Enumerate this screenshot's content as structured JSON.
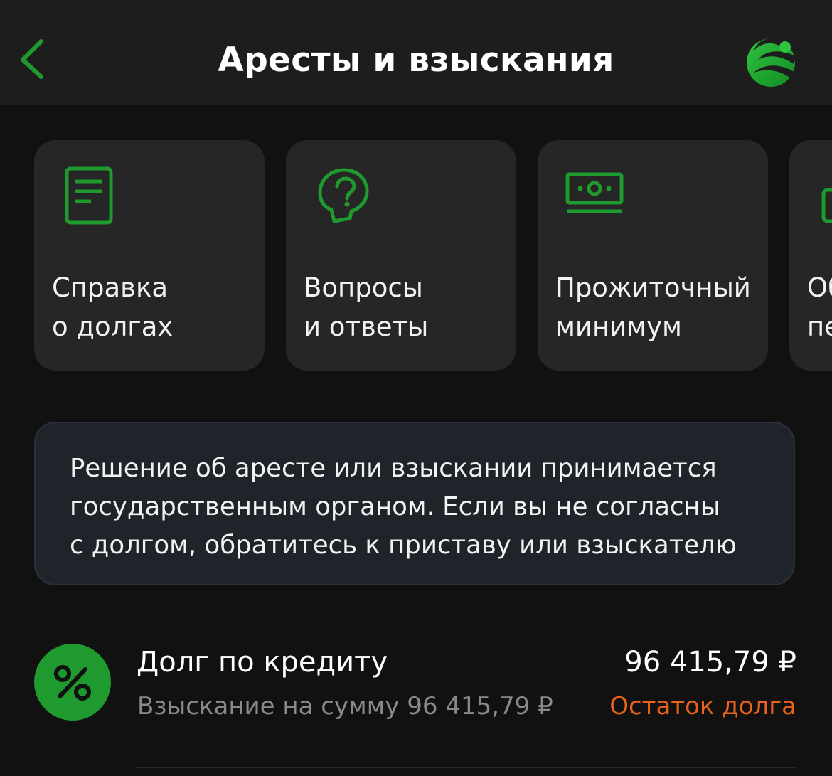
{
  "header": {
    "title": "Аресты и взыскания"
  },
  "cards": [
    {
      "icon": "document-icon",
      "label": "Справка\nо долгах"
    },
    {
      "icon": "question-head-icon",
      "label": "Вопросы\nи ответы"
    },
    {
      "icon": "money-icon",
      "label": "Прожиточный\nминимум"
    },
    {
      "icon": "briefcase-icon",
      "label": "Об\nпе"
    }
  ],
  "notice": {
    "text": "Решение об аресте или взыскании принимается\nгосударственным органом. Если вы не согласны\nс долгом, обратитесь к приставу или взыскателю"
  },
  "debts": [
    {
      "icon": "percent-icon",
      "title": "Долг по кредиту",
      "amount": "96 415,79 ₽",
      "subtitle": "Взыскание на сумму 96 415,79 ₽",
      "status": "Остаток долга"
    }
  ],
  "colors": {
    "accent_green": "#1f9a2f",
    "status_orange": "#e8621c",
    "background": "#111111",
    "card_background": "#262626"
  }
}
